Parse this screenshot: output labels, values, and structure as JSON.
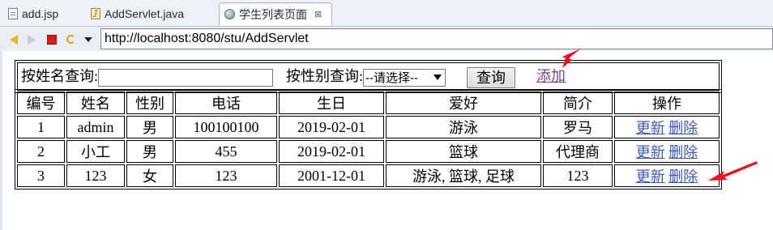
{
  "tabs": [
    {
      "label": "add.jsp",
      "icon": "jsp-file-icon",
      "active": false
    },
    {
      "label": "AddServlet.java",
      "icon": "java-file-icon",
      "active": false
    },
    {
      "label": "学生列表页面",
      "icon": "globe-icon",
      "active": true,
      "close": "⊠"
    }
  ],
  "browser": {
    "url": "http://localhost:8080/stu/AddServlet"
  },
  "search": {
    "name_label": "按姓名查询:",
    "name_value": "",
    "gender_label": "按性别查询:",
    "gender_selected": "--请选择--",
    "query_button": "查询",
    "add_link": "添加"
  },
  "table": {
    "headers": [
      "编号",
      "姓名",
      "性别",
      "电话",
      "生日",
      "爱好",
      "简介",
      "操作"
    ],
    "rows": [
      {
        "id": "1",
        "name": "admin",
        "gender": "男",
        "phone": "100100100",
        "birthday": "2019-02-01",
        "hobby": "游泳",
        "intro": "罗马",
        "edit": "更新",
        "delete": "删除"
      },
      {
        "id": "2",
        "name": "小工",
        "gender": "男",
        "phone": "455",
        "birthday": "2019-02-01",
        "hobby": "篮球",
        "intro": "代理商",
        "edit": "更新",
        "delete": "删除"
      },
      {
        "id": "3",
        "name": "123",
        "gender": "女",
        "phone": "123",
        "birthday": "2001-12-01",
        "hobby": "游泳, 篮球, 足球",
        "intro": "123",
        "edit": "更新",
        "delete": "删除"
      }
    ]
  },
  "colors": {
    "link": "#3b5ab5",
    "visited_link": "#7b3fa0",
    "annotation_arrow": "#e8121d"
  }
}
